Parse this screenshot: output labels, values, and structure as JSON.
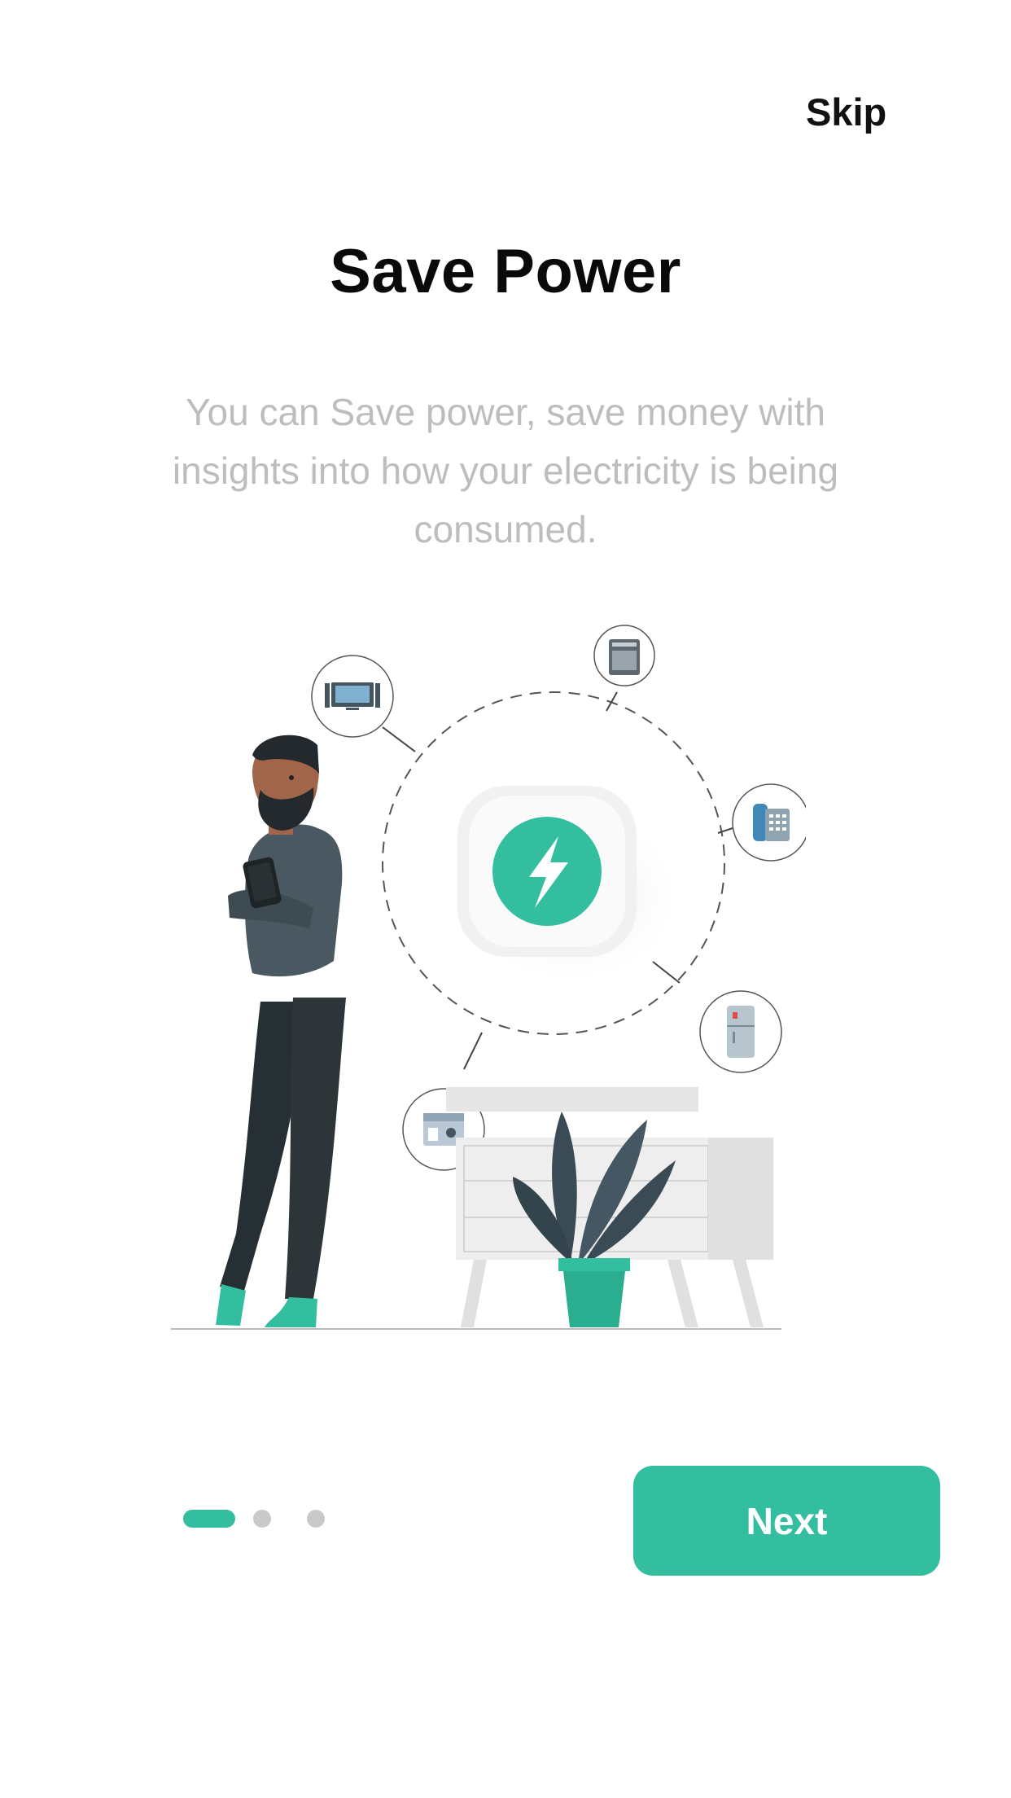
{
  "header": {
    "skip_label": "Skip"
  },
  "main": {
    "title": "Save Power",
    "description": "You can Save power, save money with insights into how your electricity is being consumed."
  },
  "pager": {
    "total": 3,
    "active_index": 0
  },
  "footer": {
    "next_label": "Next"
  },
  "colors": {
    "accent": "#33bf9f",
    "title": "#0a0a0a",
    "description": "#bdbdbd",
    "dot_inactive": "#c9c9c9"
  },
  "illustration": {
    "center_icon": "lightning-bolt-icon",
    "appliance_icons": [
      "tv-icon",
      "oven-icon",
      "telephone-icon",
      "refrigerator-icon",
      "coffee-machine-icon"
    ]
  }
}
